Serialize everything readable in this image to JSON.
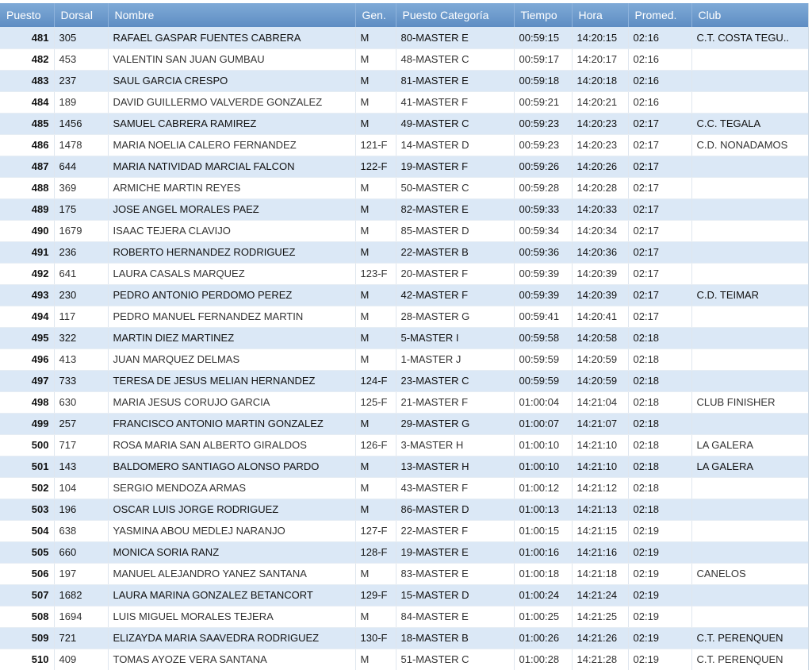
{
  "columns": [
    "Puesto",
    "Dorsal",
    "Nombre",
    "Gen.",
    "Puesto Categoría",
    "Tiempo",
    "Hora",
    "Promed.",
    "Club"
  ],
  "rows": [
    {
      "puesto": "481",
      "dorsal": "305",
      "nombre": "RAFAEL GASPAR FUENTES CABRERA",
      "gen": "M",
      "categoria": "80-MASTER E",
      "tiempo": "00:59:15",
      "hora": "14:20:15",
      "promed": "02:16",
      "club": "C.T. COSTA TEGU.."
    },
    {
      "puesto": "482",
      "dorsal": "453",
      "nombre": "VALENTIN SAN JUAN GUMBAU",
      "gen": "M",
      "categoria": "48-MASTER C",
      "tiempo": "00:59:17",
      "hora": "14:20:17",
      "promed": "02:16",
      "club": ""
    },
    {
      "puesto": "483",
      "dorsal": "237",
      "nombre": "SAUL GARCIA CRESPO",
      "gen": "M",
      "categoria": "81-MASTER E",
      "tiempo": "00:59:18",
      "hora": "14:20:18",
      "promed": "02:16",
      "club": ""
    },
    {
      "puesto": "484",
      "dorsal": "189",
      "nombre": "DAVID GUILLERMO VALVERDE GONZALEZ",
      "gen": "M",
      "categoria": "41-MASTER F",
      "tiempo": "00:59:21",
      "hora": "14:20:21",
      "promed": "02:16",
      "club": ""
    },
    {
      "puesto": "485",
      "dorsal": "1456",
      "nombre": "SAMUEL CABRERA RAMIREZ",
      "gen": "M",
      "categoria": "49-MASTER C",
      "tiempo": "00:59:23",
      "hora": "14:20:23",
      "promed": "02:17",
      "club": "C.C. TEGALA"
    },
    {
      "puesto": "486",
      "dorsal": "1478",
      "nombre": "MARIA NOELIA CALERO FERNANDEZ",
      "gen": "121-F",
      "categoria": "14-MASTER D",
      "tiempo": "00:59:23",
      "hora": "14:20:23",
      "promed": "02:17",
      "club": "C.D. NONADAMOS"
    },
    {
      "puesto": "487",
      "dorsal": "644",
      "nombre": "MARIA NATIVIDAD MARCIAL FALCON",
      "gen": "122-F",
      "categoria": "19-MASTER F",
      "tiempo": "00:59:26",
      "hora": "14:20:26",
      "promed": "02:17",
      "club": ""
    },
    {
      "puesto": "488",
      "dorsal": "369",
      "nombre": "ARMICHE MARTIN REYES",
      "gen": "M",
      "categoria": "50-MASTER C",
      "tiempo": "00:59:28",
      "hora": "14:20:28",
      "promed": "02:17",
      "club": ""
    },
    {
      "puesto": "489",
      "dorsal": "175",
      "nombre": "JOSE ANGEL MORALES PAEZ",
      "gen": "M",
      "categoria": "82-MASTER E",
      "tiempo": "00:59:33",
      "hora": "14:20:33",
      "promed": "02:17",
      "club": ""
    },
    {
      "puesto": "490",
      "dorsal": "1679",
      "nombre": "ISAAC TEJERA CLAVIJO",
      "gen": "M",
      "categoria": "85-MASTER D",
      "tiempo": "00:59:34",
      "hora": "14:20:34",
      "promed": "02:17",
      "club": ""
    },
    {
      "puesto": "491",
      "dorsal": "236",
      "nombre": "ROBERTO HERNANDEZ RODRIGUEZ",
      "gen": "M",
      "categoria": "22-MASTER B",
      "tiempo": "00:59:36",
      "hora": "14:20:36",
      "promed": "02:17",
      "club": ""
    },
    {
      "puesto": "492",
      "dorsal": "641",
      "nombre": "LAURA CASALS MARQUEZ",
      "gen": "123-F",
      "categoria": "20-MASTER F",
      "tiempo": "00:59:39",
      "hora": "14:20:39",
      "promed": "02:17",
      "club": ""
    },
    {
      "puesto": "493",
      "dorsal": "230",
      "nombre": "PEDRO ANTONIO PERDOMO PEREZ",
      "gen": "M",
      "categoria": "42-MASTER F",
      "tiempo": "00:59:39",
      "hora": "14:20:39",
      "promed": "02:17",
      "club": "C.D. TEIMAR"
    },
    {
      "puesto": "494",
      "dorsal": "117",
      "nombre": "PEDRO MANUEL FERNANDEZ MARTIN",
      "gen": "M",
      "categoria": "28-MASTER G",
      "tiempo": "00:59:41",
      "hora": "14:20:41",
      "promed": "02:17",
      "club": ""
    },
    {
      "puesto": "495",
      "dorsal": "322",
      "nombre": "MARTIN DIEZ MARTINEZ",
      "gen": "M",
      "categoria": "5-MASTER I",
      "tiempo": "00:59:58",
      "hora": "14:20:58",
      "promed": "02:18",
      "club": ""
    },
    {
      "puesto": "496",
      "dorsal": "413",
      "nombre": "JUAN MARQUEZ DELMAS",
      "gen": "M",
      "categoria": "1-MASTER J",
      "tiempo": "00:59:59",
      "hora": "14:20:59",
      "promed": "02:18",
      "club": ""
    },
    {
      "puesto": "497",
      "dorsal": "733",
      "nombre": "TERESA DE JESUS MELIAN HERNANDEZ",
      "gen": "124-F",
      "categoria": "23-MASTER C",
      "tiempo": "00:59:59",
      "hora": "14:20:59",
      "promed": "02:18",
      "club": ""
    },
    {
      "puesto": "498",
      "dorsal": "630",
      "nombre": "MARIA JESUS CORUJO GARCIA",
      "gen": "125-F",
      "categoria": "21-MASTER F",
      "tiempo": "01:00:04",
      "hora": "14:21:04",
      "promed": "02:18",
      "club": "CLUB FINISHER"
    },
    {
      "puesto": "499",
      "dorsal": "257",
      "nombre": "FRANCISCO ANTONIO MARTIN GONZALEZ",
      "gen": "M",
      "categoria": "29-MASTER G",
      "tiempo": "01:00:07",
      "hora": "14:21:07",
      "promed": "02:18",
      "club": ""
    },
    {
      "puesto": "500",
      "dorsal": "717",
      "nombre": "ROSA MARIA SAN ALBERTO GIRALDOS",
      "gen": "126-F",
      "categoria": "3-MASTER H",
      "tiempo": "01:00:10",
      "hora": "14:21:10",
      "promed": "02:18",
      "club": "LA GALERA"
    },
    {
      "puesto": "501",
      "dorsal": "143",
      "nombre": "BALDOMERO SANTIAGO ALONSO PARDO",
      "gen": "M",
      "categoria": "13-MASTER H",
      "tiempo": "01:00:10",
      "hora": "14:21:10",
      "promed": "02:18",
      "club": "LA GALERA"
    },
    {
      "puesto": "502",
      "dorsal": "104",
      "nombre": "SERGIO MENDOZA ARMAS",
      "gen": "M",
      "categoria": "43-MASTER F",
      "tiempo": "01:00:12",
      "hora": "14:21:12",
      "promed": "02:18",
      "club": ""
    },
    {
      "puesto": "503",
      "dorsal": "196",
      "nombre": "OSCAR LUIS JORGE RODRIGUEZ",
      "gen": "M",
      "categoria": "86-MASTER D",
      "tiempo": "01:00:13",
      "hora": "14:21:13",
      "promed": "02:18",
      "club": ""
    },
    {
      "puesto": "504",
      "dorsal": "638",
      "nombre": "YASMINA ABOU MEDLEJ NARANJO",
      "gen": "127-F",
      "categoria": "22-MASTER F",
      "tiempo": "01:00:15",
      "hora": "14:21:15",
      "promed": "02:19",
      "club": ""
    },
    {
      "puesto": "505",
      "dorsal": "660",
      "nombre": "MONICA SORIA RANZ",
      "gen": "128-F",
      "categoria": "19-MASTER E",
      "tiempo": "01:00:16",
      "hora": "14:21:16",
      "promed": "02:19",
      "club": ""
    },
    {
      "puesto": "506",
      "dorsal": "197",
      "nombre": "MANUEL ALEJANDRO YANEZ SANTANA",
      "gen": "M",
      "categoria": "83-MASTER E",
      "tiempo": "01:00:18",
      "hora": "14:21:18",
      "promed": "02:19",
      "club": "CANELOS"
    },
    {
      "puesto": "507",
      "dorsal": "1682",
      "nombre": "LAURA MARINA GONZALEZ BETANCORT",
      "gen": "129-F",
      "categoria": "15-MASTER D",
      "tiempo": "01:00:24",
      "hora": "14:21:24",
      "promed": "02:19",
      "club": ""
    },
    {
      "puesto": "508",
      "dorsal": "1694",
      "nombre": "LUIS MIGUEL MORALES TEJERA",
      "gen": "M",
      "categoria": "84-MASTER E",
      "tiempo": "01:00:25",
      "hora": "14:21:25",
      "promed": "02:19",
      "club": ""
    },
    {
      "puesto": "509",
      "dorsal": "721",
      "nombre": "ELIZAYDA MARIA SAAVEDRA RODRIGUEZ",
      "gen": "130-F",
      "categoria": "18-MASTER B",
      "tiempo": "01:00:26",
      "hora": "14:21:26",
      "promed": "02:19",
      "club": "C.T. PERENQUEN"
    },
    {
      "puesto": "510",
      "dorsal": "409",
      "nombre": "TOMAS AYOZE VERA SANTANA",
      "gen": "M",
      "categoria": "51-MASTER C",
      "tiempo": "01:00:28",
      "hora": "14:21:28",
      "promed": "02:19",
      "club": "C.T. PERENQUEN"
    }
  ]
}
